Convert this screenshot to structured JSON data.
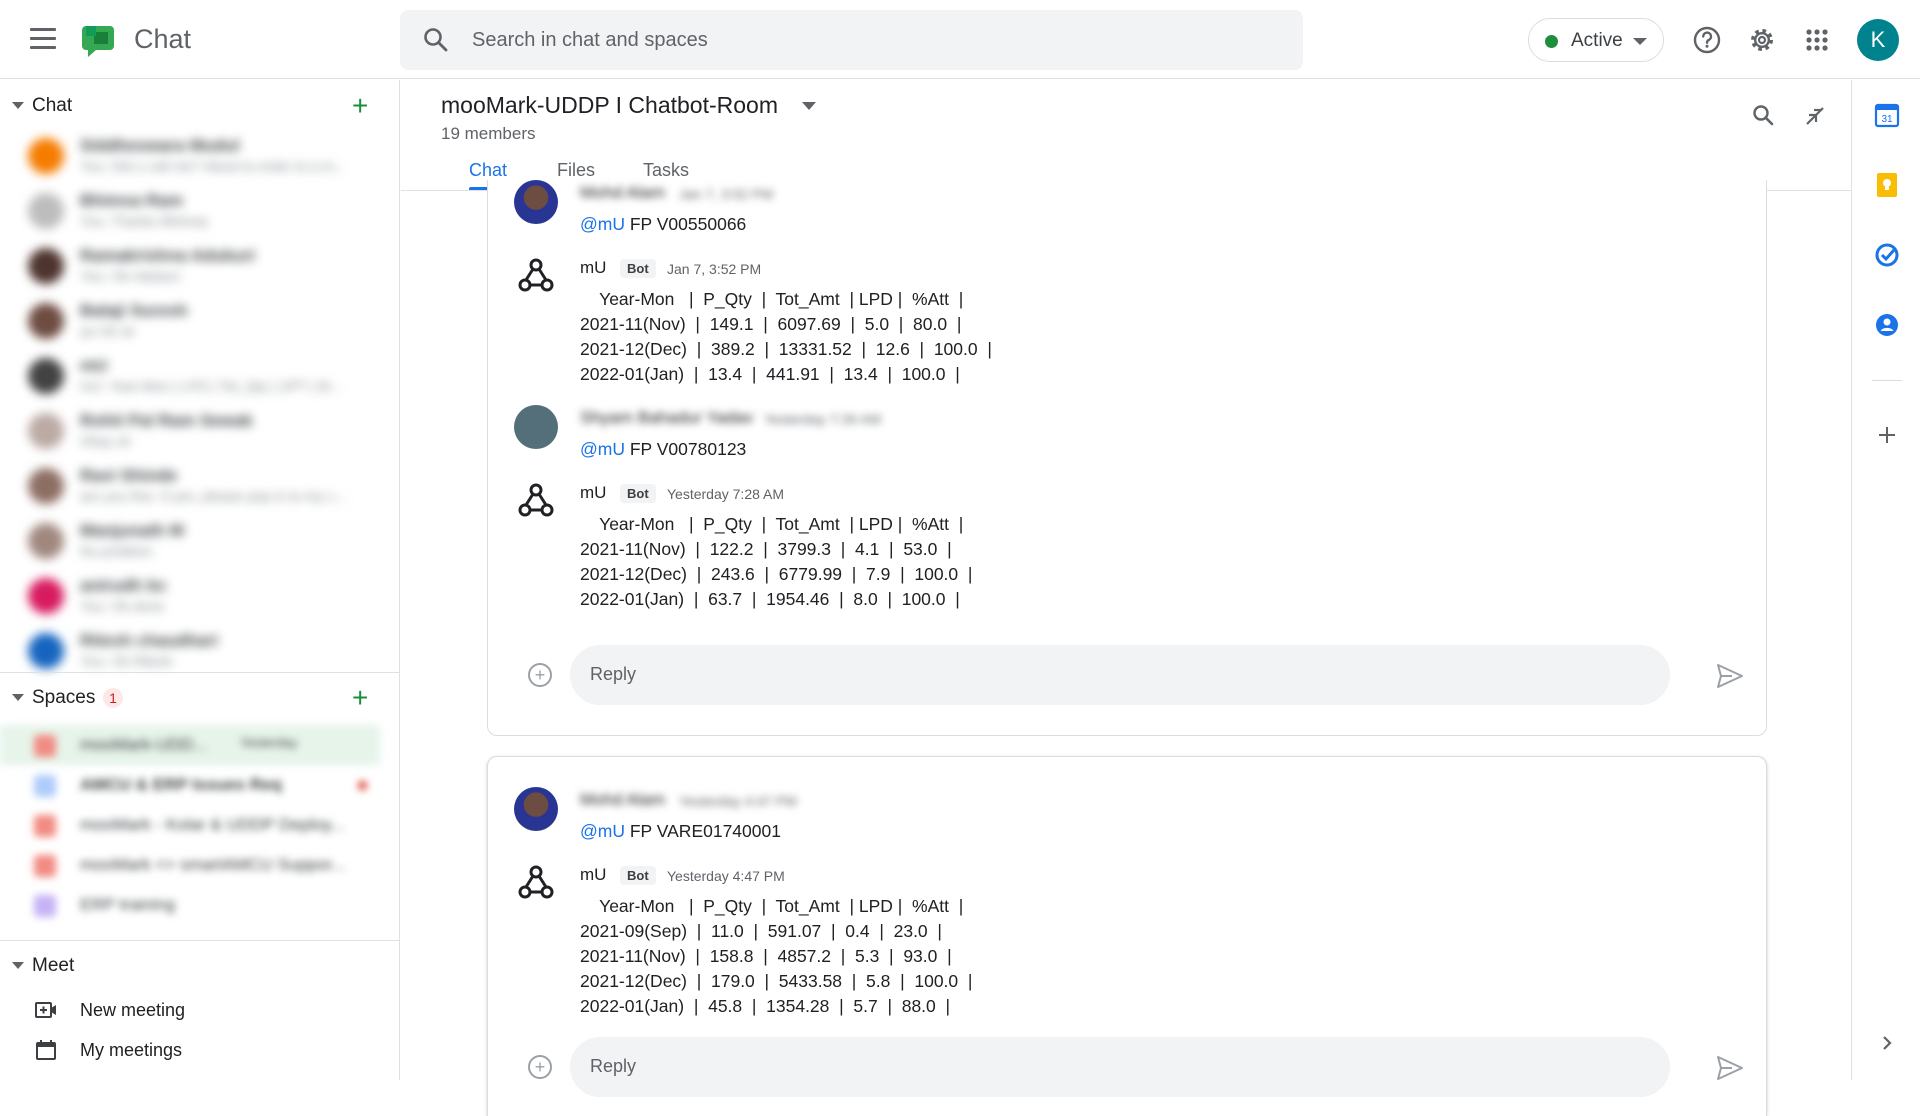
{
  "app": {
    "title": "Chat"
  },
  "search": {
    "placeholder": "Search in chat and spaces"
  },
  "status": {
    "label": "Active",
    "color": "#1e8e3e"
  },
  "account": {
    "initial": "K"
  },
  "sidebar": {
    "chat_section": "Chat",
    "direct_messages": [
      {
        "name": "Siddheswara Mudul",
        "preview": "You: Did u call me? About to enter to a m..."
      },
      {
        "name": "Bhimsa Ram",
        "preview": "You: Thanks Bhimsa"
      },
      {
        "name": "Ramakrishna Adukuri",
        "preview": "You: Ok Adukuri"
      },
      {
        "name": "Balaji Suresh",
        "preview": "ya Ok sir"
      },
      {
        "name": "mU",
        "preview": "mU: Year-Mon | LPD | Tot_Qty | UPT | M..."
      },
      {
        "name": "Rohit Pal Ram Sewak",
        "preview": "Okay sir"
      },
      {
        "name": "Ravi Shinde",
        "preview": "are you fine. If yes, please pop in to my c..."
      },
      {
        "name": "Manjunath M",
        "preview": "No problem"
      },
      {
        "name": "anirudh bc",
        "preview": "You: Ok done"
      },
      {
        "name": "Ritesh chaudhari",
        "preview": "You: Ok Ritesh"
      }
    ],
    "spaces_section": "Spaces",
    "spaces_count": "1",
    "spaces": [
      {
        "name": "mooMark-UDD...",
        "meta": "Yesterday"
      },
      {
        "name": "AMCU & ERP Issues Req"
      },
      {
        "name": "mooMark - Kolar & UDDP Deploy..."
      },
      {
        "name": "mooMark <> smartAMCU Suppor..."
      },
      {
        "name": "ERP training"
      }
    ],
    "meet_section": "Meet",
    "meet_items": [
      "New meeting",
      "My meetings"
    ]
  },
  "room": {
    "title": "mooMark-UDDP I Chatbot-Room",
    "members": "19 members",
    "tabs": [
      "Chat",
      "Files",
      "Tasks"
    ]
  },
  "thread1": {
    "msg1": {
      "sender": "Mohd Alam",
      "time": "Jan 7, 3:52 PM",
      "mention": "@mU",
      "text": " FP V00550066"
    },
    "bot1": {
      "sender": "mU",
      "badge": "Bot",
      "time": "Jan 7, 3:52 PM",
      "lines": [
        "    Year-Mon   |  P_Qty  |  Tot_Amt  | LPD |  %Att  |",
        "2021-11(Nov)  |  149.1  |  6097.69  |  5.0  |  80.0  |",
        "2021-12(Dec)  |  389.2  |  13331.52  |  12.6  |  100.0  |",
        "2022-01(Jan)  |  13.4  |  441.91  |  13.4  |  100.0  |"
      ]
    },
    "msg2": {
      "sender": "Shyam Bahadur Yadav",
      "time": "Yesterday 7:26 AM",
      "mention": "@mU",
      "text": " FP V00780123"
    },
    "bot2": {
      "sender": "mU",
      "badge": "Bot",
      "time": "Yesterday 7:28 AM",
      "lines": [
        "    Year-Mon   |  P_Qty  |  Tot_Amt  | LPD |  %Att  |",
        "2021-11(Nov)  |  122.2  |  3799.3  |  4.1  |  53.0  |",
        "2021-12(Dec)  |  243.6  |  6779.99  |  7.9  |  100.0  |",
        "2022-01(Jan)  |  63.7  |  1954.46  |  8.0  |  100.0  |"
      ]
    },
    "reply_placeholder": "Reply"
  },
  "thread2": {
    "msg1": {
      "sender": "Mohd Alam",
      "time": "Yesterday 4:47 PM",
      "mention": "@mU",
      "text": " FP VARE01740001"
    },
    "bot1": {
      "sender": "mU",
      "badge": "Bot",
      "time": "Yesterday 4:47 PM",
      "lines": [
        "    Year-Mon   |  P_Qty  |  Tot_Amt  | LPD |  %Att  |",
        "2021-09(Sep)  |  11.0  |  591.07  |  0.4  |  23.0  |",
        "2021-11(Nov)  |  158.8  |  4857.2  |  5.3  |  93.0  |",
        "2021-12(Dec)  |  179.0  |  5433.58  |  5.8  |  100.0  |",
        "2022-01(Jan)  |  45.8  |  1354.28  |  5.7  |  88.0  |"
      ]
    },
    "reply_placeholder": "Reply"
  },
  "rail_icons": [
    "calendar-icon",
    "keep-icon",
    "tasks-icon",
    "contacts-icon",
    "add-icon"
  ],
  "colors": {
    "accent": "#1a73e8",
    "brand_green": "#1e8e3e",
    "avatar": "#00838f"
  }
}
